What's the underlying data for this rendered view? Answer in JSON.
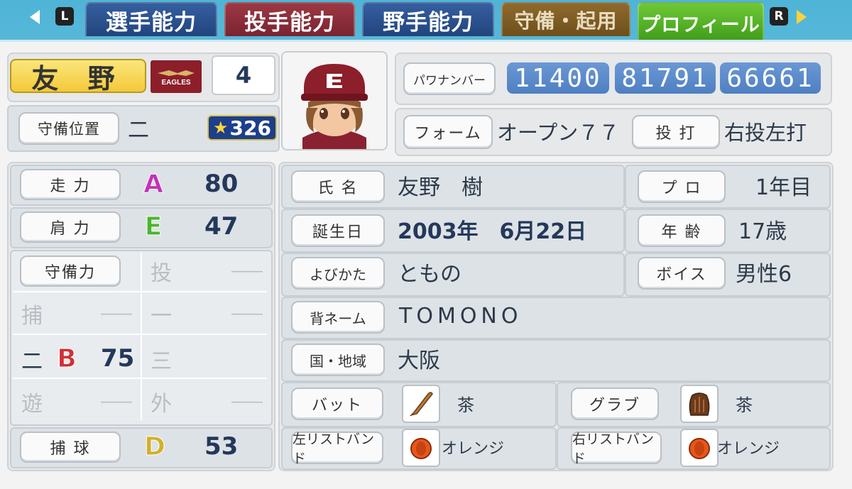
{
  "tabs": {
    "left_key": "L",
    "right_key": "R",
    "items": [
      {
        "label": "選手能力"
      },
      {
        "label": "投手能力"
      },
      {
        "label": "野手能力"
      },
      {
        "label": "守備・起用"
      },
      {
        "label": "プロフィール"
      }
    ]
  },
  "player": {
    "short_name": "友 野",
    "team_logo_text": "EAGLES",
    "uniform_number": "4",
    "position_label": "守備位置",
    "position": "二",
    "star_rating": "326"
  },
  "pawa_number": {
    "label": "パワナンバー",
    "parts": [
      "11400",
      "81791",
      "66661"
    ]
  },
  "form": {
    "label": "フォーム",
    "value": "オープン７７"
  },
  "throw_bat": {
    "label": "投 打",
    "value": "右投左打"
  },
  "abilities": {
    "speed": {
      "label": "走 力",
      "grade": "A",
      "value": "80",
      "grade_color": "#c233b8"
    },
    "arm": {
      "label": "肩 力",
      "grade": "E",
      "value": "47",
      "grade_color": "#4bb52e"
    },
    "defense_label": "守備力",
    "catch": {
      "label": "捕 球",
      "grade": "D",
      "value": "53",
      "grade_color": "#d3b02a"
    }
  },
  "defense_positions": [
    {
      "pos": "投",
      "grade": "",
      "value": "――",
      "active": false
    },
    {
      "pos": "捕",
      "grade": "――",
      "value": "――",
      "active": false
    },
    {
      "pos": "一",
      "grade": "",
      "value": "――",
      "active": false
    },
    {
      "pos": "二",
      "grade": "B",
      "value": "75",
      "active": true,
      "grade_color": "#d03036"
    },
    {
      "pos": "三",
      "grade": "",
      "value": "――",
      "active": false
    },
    {
      "pos": "遊",
      "grade": "――",
      "value": "――",
      "active": false
    },
    {
      "pos": "外",
      "grade": "",
      "value": "――",
      "active": false
    }
  ],
  "profile": {
    "name": {
      "label": "氏 名",
      "value": "友野　樹"
    },
    "pro": {
      "label": "プ ロ",
      "value": "1年目"
    },
    "birthday": {
      "label": "誕生日",
      "value": "2003年　6月22日"
    },
    "age": {
      "label": "年 齢",
      "value": "17歳"
    },
    "reading": {
      "label": "よびかた",
      "value": "ともの"
    },
    "voice": {
      "label": "ボイス",
      "value": "男性6"
    },
    "back_name": {
      "label": "背ネーム",
      "value": "TOMONO"
    },
    "region": {
      "label": "国・地域",
      "value": "大阪"
    }
  },
  "equipment": {
    "bat": {
      "label": "バット",
      "value": "茶"
    },
    "glove": {
      "label": "グラブ",
      "value": "茶"
    },
    "left_wristband": {
      "label": "左リストバンド",
      "value": "オレンジ"
    },
    "right_wristband": {
      "label": "右リストバンド",
      "value": "オレンジ"
    }
  },
  "colors": {
    "accent_blue": "#4f7fc2",
    "tab_active": "#4f9e23"
  }
}
